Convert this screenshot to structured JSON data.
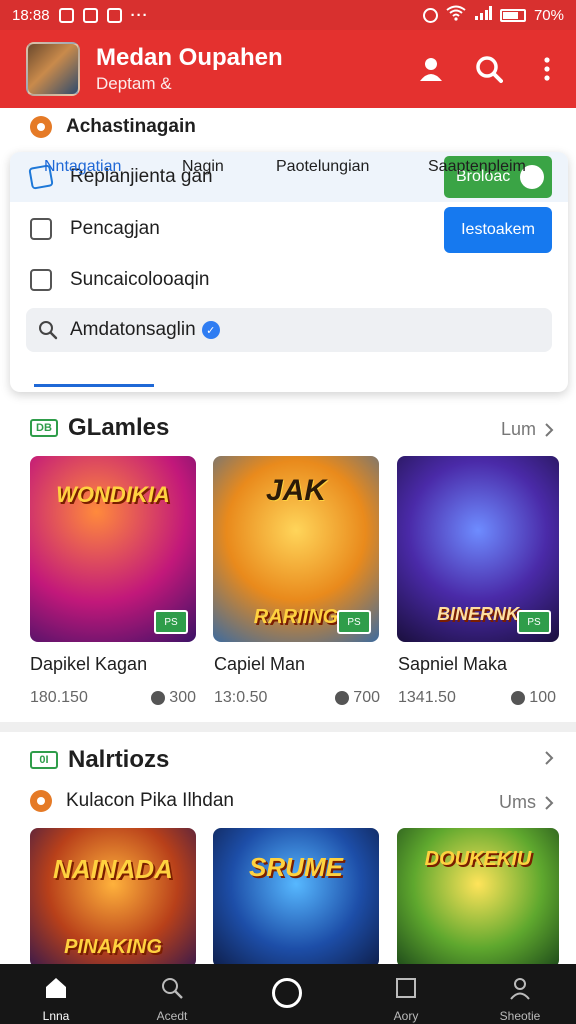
{
  "status": {
    "time": "18:88",
    "battery": "70%"
  },
  "appbar": {
    "title": "Medan Oupahen",
    "subtitle": "Deptam &"
  },
  "section_top": {
    "label": "Achastinagain"
  },
  "options": [
    {
      "label": "Replanjienta gan",
      "button": "Broloac"
    },
    {
      "label": "Pencagjan",
      "button": "Iestoakem"
    },
    {
      "label": "Suncaicolooaqin"
    }
  ],
  "search": {
    "value": "Amdatonsaglin"
  },
  "tabs": [
    "Nntagatian",
    "Nagin",
    "Paotelungian",
    "Saaptenpleim"
  ],
  "games_section": {
    "title": "GLamles",
    "badge": "DB",
    "more": "Lum",
    "items": [
      {
        "logo": "WONDIKIA",
        "name": "Dapikel Kagan",
        "size": "180.150",
        "count": "300",
        "tag": "PS"
      },
      {
        "logo": "JAK",
        "logo2": "RARIING",
        "name": "Capiel Man",
        "size": "13:0.50",
        "count": "700",
        "tag": "PS"
      },
      {
        "logo": "BINERNK",
        "name": "Sapniel Maka",
        "size": "1341.50",
        "count": "100",
        "tag": "PS"
      }
    ]
  },
  "news_section": {
    "title": "Nalrtiozs",
    "badge": "0I",
    "subtitle": "Kulacon Pika Ilhdan",
    "more": "Ums",
    "items": [
      {
        "logo": "NAINADA",
        "logo2": "PINAKING"
      },
      {
        "logo": "SRUME"
      },
      {
        "logo": "DOUKEKIU"
      }
    ]
  },
  "nav": [
    "Lnna",
    "Acedt",
    "",
    "Aory",
    "Sheotie"
  ],
  "colors": {
    "brand": "#e4312f",
    "status": "#d8302f",
    "accent_blue": "#1679ef",
    "accent_green": "#3aa445"
  }
}
